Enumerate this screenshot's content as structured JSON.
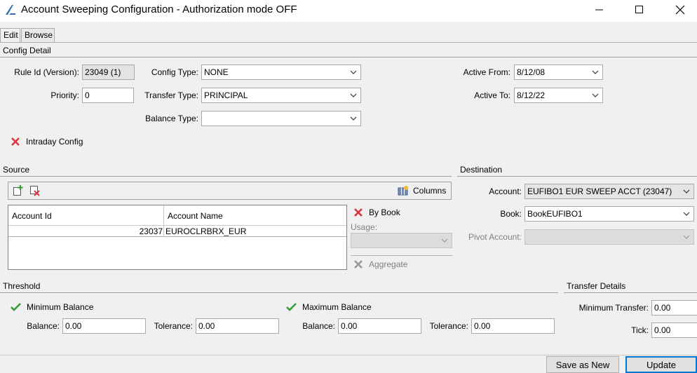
{
  "window": {
    "title": "Account Sweeping Configuration - Authorization mode OFF",
    "icon": "app-logo-icon",
    "controls": [
      "minimize-icon",
      "maximize-icon",
      "close-icon"
    ]
  },
  "tabs": [
    {
      "label": "Edit",
      "active": true
    },
    {
      "label": "Browse",
      "active": false
    }
  ],
  "config_detail": {
    "title": "Config Detail",
    "rule_id_label": "Rule Id (Version):",
    "rule_id_value": "23049 (1)",
    "priority_label": "Priority:",
    "priority_value": "0",
    "config_type_label": "Config Type:",
    "config_type_value": "NONE",
    "transfer_type_label": "Transfer Type:",
    "transfer_type_value": "PRINCIPAL",
    "balance_type_label": "Balance Type:",
    "balance_type_value": "",
    "active_from_label": "Active From:",
    "active_from_value": "8/12/08",
    "active_to_label": "Active To:",
    "active_to_value": "8/12/22",
    "intraday_label": "Intraday Config"
  },
  "source": {
    "title": "Source",
    "columns_button": "Columns",
    "table": {
      "headers": [
        "Account Id",
        "Account Name"
      ],
      "rows": [
        {
          "account_id": "23037",
          "account_name": "EUROCLRBRX_EUR"
        }
      ]
    },
    "by_book_label": "By Book",
    "usage_label": "Usage:",
    "usage_value": "",
    "aggregate_label": "Aggregate"
  },
  "destination": {
    "title": "Destination",
    "account_label": "Account:",
    "account_value": "EUFIBO1 EUR SWEEP ACCT (23047)",
    "book_label": "Book:",
    "book_value": "BookEUFIBO1",
    "pivot_label": "Pivot Account:",
    "pivot_value": ""
  },
  "threshold": {
    "title": "Threshold",
    "min_label": "Minimum Balance",
    "min_balance_label": "Balance:",
    "min_balance_value": "0.00",
    "min_tolerance_label": "Tolerance:",
    "min_tolerance_value": "0.00",
    "max_label": "Maximum Balance",
    "max_balance_label": "Balance:",
    "max_balance_value": "0.00",
    "max_tolerance_label": "Tolerance:",
    "max_tolerance_value": "0.00"
  },
  "transfer_details": {
    "title": "Transfer Details",
    "min_transfer_label": "Minimum Transfer:",
    "min_transfer_value": "0.00",
    "tick_label": "Tick:",
    "tick_value": "0.00"
  },
  "footer": {
    "save_as_new": "Save as New",
    "update": "Update"
  },
  "colors": {
    "accent": "#0078d7",
    "error_red": "#d9363e",
    "ok_green": "#3a9c3a"
  }
}
